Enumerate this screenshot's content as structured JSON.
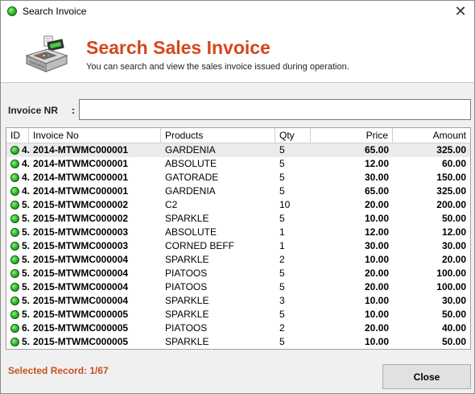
{
  "window": {
    "title": "Search Invoice",
    "close_glyph": "✕"
  },
  "header": {
    "title": "Search Sales Invoice",
    "subtitle": "You can search and view the sales invoice issued during operation.",
    "icon": "cash-register-icon"
  },
  "search": {
    "label": "Invoice NR",
    "colon": ":",
    "value": "",
    "placeholder": ""
  },
  "grid": {
    "columns": [
      "ID",
      "Invoice No",
      "Products",
      "Qty",
      "Price",
      "Amount"
    ],
    "rows": [
      {
        "id": "4.",
        "invoice": "2014-MTWMC000001",
        "product": "GARDENIA",
        "qty": "5",
        "price": "65.00",
        "amount": "325.00",
        "selected": true
      },
      {
        "id": "4.",
        "invoice": "2014-MTWMC000001",
        "product": "ABSOLUTE",
        "qty": "5",
        "price": "12.00",
        "amount": "60.00"
      },
      {
        "id": "4.",
        "invoice": "2014-MTWMC000001",
        "product": "GATORADE",
        "qty": "5",
        "price": "30.00",
        "amount": "150.00"
      },
      {
        "id": "4.",
        "invoice": "2014-MTWMC000001",
        "product": "GARDENIA",
        "qty": "5",
        "price": "65.00",
        "amount": "325.00"
      },
      {
        "id": "5.",
        "invoice": "2015-MTWMC000002",
        "product": "C2",
        "qty": "10",
        "price": "20.00",
        "amount": "200.00"
      },
      {
        "id": "5.",
        "invoice": "2015-MTWMC000002",
        "product": "SPARKLE",
        "qty": "5",
        "price": "10.00",
        "amount": "50.00"
      },
      {
        "id": "5.",
        "invoice": "2015-MTWMC000003",
        "product": "ABSOLUTE",
        "qty": "1",
        "price": "12.00",
        "amount": "12.00"
      },
      {
        "id": "5.",
        "invoice": "2015-MTWMC000003",
        "product": "CORNED BEFF",
        "qty": "1",
        "price": "30.00",
        "amount": "30.00"
      },
      {
        "id": "5.",
        "invoice": "2015-MTWMC000004",
        "product": "SPARKLE",
        "qty": "2",
        "price": "10.00",
        "amount": "20.00"
      },
      {
        "id": "5.",
        "invoice": "2015-MTWMC000004",
        "product": "PIATOOS",
        "qty": "5",
        "price": "20.00",
        "amount": "100.00"
      },
      {
        "id": "5.",
        "invoice": "2015-MTWMC000004",
        "product": "PIATOOS",
        "qty": "5",
        "price": "20.00",
        "amount": "100.00"
      },
      {
        "id": "5.",
        "invoice": "2015-MTWMC000004",
        "product": "SPARKLE",
        "qty": "3",
        "price": "10.00",
        "amount": "30.00"
      },
      {
        "id": "5.",
        "invoice": "2015-MTWMC000005",
        "product": "SPARKLE",
        "qty": "5",
        "price": "10.00",
        "amount": "50.00"
      },
      {
        "id": "6.",
        "invoice": "2015-MTWMC000005",
        "product": "PIATOOS",
        "qty": "2",
        "price": "20.00",
        "amount": "40.00"
      },
      {
        "id": "5.",
        "invoice": "2015-MTWMC000005",
        "product": "SPARKLE",
        "qty": "5",
        "price": "10.00",
        "amount": "50.00"
      }
    ]
  },
  "status": {
    "text": "Selected Record: 1/67"
  },
  "buttons": {
    "close_label": "Close"
  },
  "colors": {
    "accent": "#d4481c",
    "status": "#c8501e",
    "row_dot": "#2fb22a",
    "selected_row": "#ebebeb"
  }
}
